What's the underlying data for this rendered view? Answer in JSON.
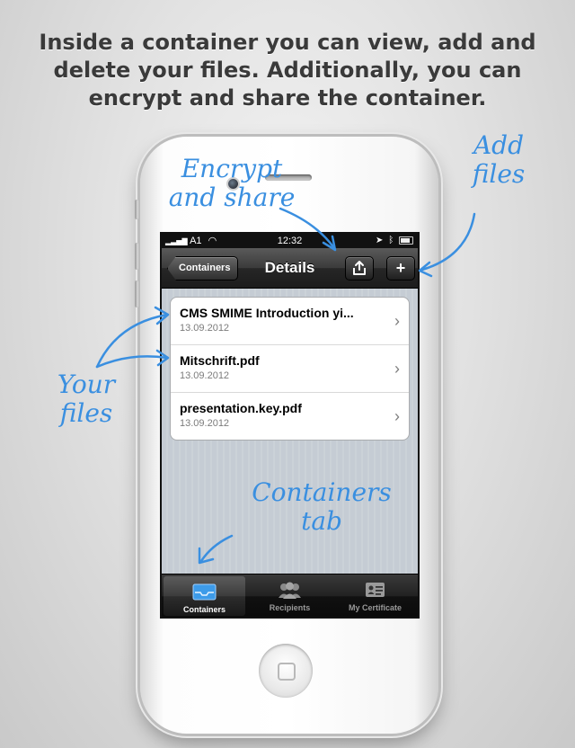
{
  "headline": "Inside a container you can view, add and delete your files. Additionally, you can encrypt and share the container.",
  "status": {
    "carrier": "A1",
    "time": "12:32"
  },
  "nav": {
    "back_label": "Containers",
    "title": "Details",
    "share_icon": "share-icon",
    "add_label": "+"
  },
  "files": [
    {
      "name": "CMS SMIME Introduction yi...",
      "date": "13.09.2012"
    },
    {
      "name": "Mitschrift.pdf",
      "date": "13.09.2012"
    },
    {
      "name": "presentation.key.pdf",
      "date": "13.09.2012"
    }
  ],
  "tabs": [
    {
      "label": "Containers",
      "icon": "inbox-tray-icon",
      "active": true
    },
    {
      "label": "Recipients",
      "icon": "people-icon",
      "active": false
    },
    {
      "label": "My Certificate",
      "icon": "certificate-card-icon",
      "active": false
    }
  ],
  "annotations": {
    "encrypt_line1": "Encrypt",
    "encrypt_line2": "and share",
    "add_line1": "Add",
    "add_line2": "files",
    "your_line1": "Your",
    "your_line2": "files",
    "containers_line1": "Containers",
    "containers_line2": "tab"
  },
  "colors": {
    "annotation": "#3a8fe0",
    "table_bg": "#c5ccd4",
    "nav_bar": "#2b2b2b"
  }
}
